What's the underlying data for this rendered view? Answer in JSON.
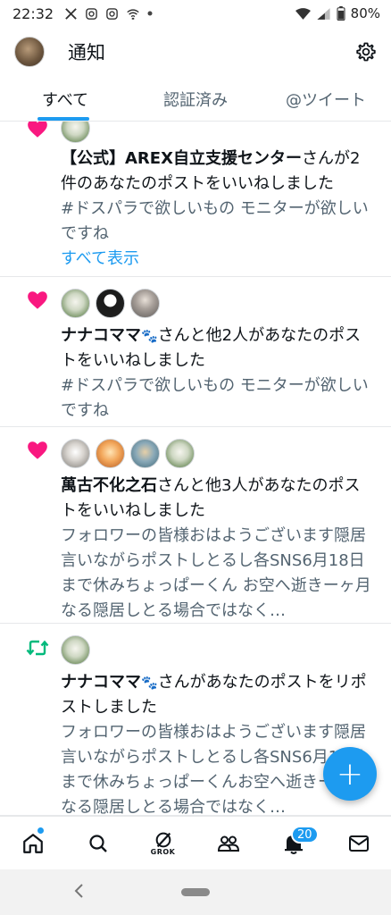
{
  "status_bar": {
    "time": "22:32",
    "battery": "80%",
    "notification_icons": [
      "x-icon",
      "instagram-icon",
      "instagram-icon",
      "wifi-cast-icon",
      "dot"
    ]
  },
  "header": {
    "title": "通知"
  },
  "tabs": [
    {
      "label": "すべて",
      "active": true
    },
    {
      "label": "認証済み",
      "active": false
    },
    {
      "label": "@ツイート",
      "active": false
    }
  ],
  "notifications": [
    {
      "type": "like",
      "actor": "【公式】AREX自立支援センター",
      "action": "さんが2件のあなたのポストをいいねしました",
      "preview": "#ドスパラで欲しいもの モニターが欲しいですね",
      "show_all": "すべて表示"
    },
    {
      "type": "like",
      "actor": "ナナコママ",
      "actor_emoji": "🐾",
      "action": "さんと他2人があなたのポストをいいねしました",
      "preview": "#ドスパラで欲しいもの モニターが欲しいですね"
    },
    {
      "type": "like",
      "actor": "萬古不化之石",
      "action": "さんと他3人があなたのポストをいいねしました",
      "preview": "フォロワーの皆様おはようございます隠居言いながらポストしとるし各SNS6月18日まで休みちょっぱーくん お空へ逝きーヶ月なる隠居しとる場合ではなく…"
    },
    {
      "type": "repost",
      "actor": "ナナコママ",
      "actor_emoji": "🐾",
      "action": "さんがあなたのポストをリポストしました",
      "preview": "フォロワーの皆様おはようございます隠居言いながらポストしとるし各SNS6月18日まで休みちょっぱーくんお空へ逝きーヶ月なる隠居しとる場合ではなく…"
    }
  ],
  "fab": {
    "label": "+"
  },
  "bottom_nav": {
    "grok_label": "GROK",
    "notifications_badge": "20"
  },
  "colors": {
    "accent": "#1d9bf0",
    "like": "#f91880",
    "repost": "#00ba7c",
    "secondary_text": "#536471"
  }
}
